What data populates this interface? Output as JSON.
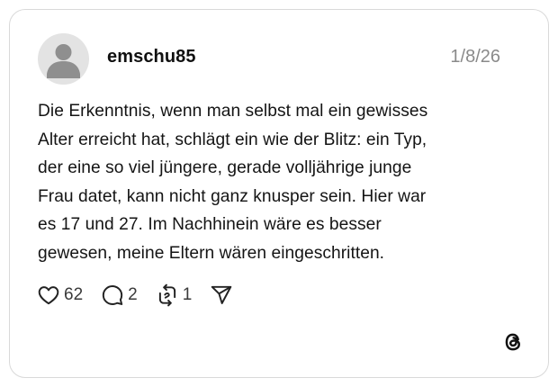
{
  "post": {
    "username": "emschu85",
    "date": "1/8/26",
    "text_lines": [
      "Die Erkenntnis, wenn man selbst mal ein gewisses",
      "Alter erreicht hat, schlägt ein wie der Blitz: ein Typ,",
      "der eine so viel jüngere, gerade volljährige junge",
      "Frau datet, kann nicht ganz knusper sein. Hier war",
      "es 17 und 27. Im Nachhinein wäre es besser",
      "gewesen, meine Eltern wären eingeschritten."
    ],
    "stats": {
      "likes": "62",
      "replies": "2",
      "reposts": "1"
    }
  },
  "icons": {
    "avatar": "default-avatar-icon",
    "like": "heart-icon",
    "reply": "comment-bubble-icon",
    "repost": "repost-icon",
    "share": "send-icon",
    "brand": "threads-logo-icon"
  },
  "colors": {
    "username": "#101010",
    "date": "#8a8a8a",
    "text": "#141414",
    "border": "#d9d9d9",
    "avatar_bg": "#e3e3e3",
    "avatar_fg": "#8f8f8f"
  }
}
